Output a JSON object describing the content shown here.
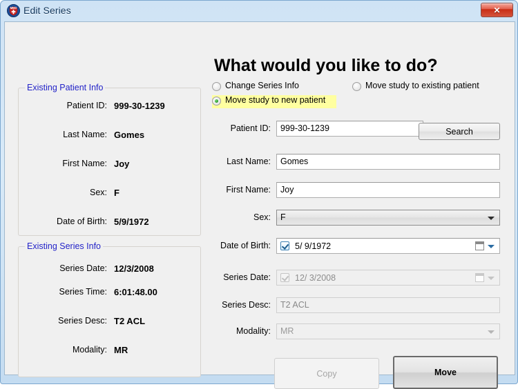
{
  "window": {
    "title": "Edit Series",
    "icon": "med-shield-icon",
    "close_label": "✕",
    "accent_blue": "#2323c8",
    "highlight_yellow": "#ffffa0",
    "close_red": "#c92d15"
  },
  "patient_group": {
    "title": "Existing Patient Info",
    "rows": [
      {
        "label": "Patient ID:",
        "value": "999-30-1239"
      },
      {
        "label": "Last Name:",
        "value": "Gomes"
      },
      {
        "label": "First Name:",
        "value": "Joy"
      },
      {
        "label": "Sex:",
        "value": "F"
      },
      {
        "label": "Date of Birth:",
        "value": "5/9/1972"
      }
    ]
  },
  "series_group": {
    "title": "Existing Series Info",
    "rows": [
      {
        "label": "Series Date:",
        "value": "12/3/2008"
      },
      {
        "label": "Series Time:",
        "value": "6:01:48.00"
      },
      {
        "label": "Series Desc:",
        "value": "T2 ACL"
      },
      {
        "label": "Modality:",
        "value": "MR"
      }
    ]
  },
  "main": {
    "heading": "What would you like to do?",
    "options": [
      {
        "label": "Change Series Info",
        "selected": false,
        "highlighted": false
      },
      {
        "label": "Move study to existing patient",
        "selected": false,
        "highlighted": false
      },
      {
        "label": "Move study to new patient",
        "selected": true,
        "highlighted": true
      }
    ],
    "fields": [
      {
        "label": "Patient ID:",
        "value": "999-30-1239",
        "type": "text",
        "disabled": false
      },
      {
        "label": "Last Name:",
        "value": "Gomes",
        "type": "text",
        "disabled": false
      },
      {
        "label": "First Name:",
        "value": "Joy",
        "type": "text",
        "disabled": false
      },
      {
        "label": "Sex:",
        "value": "F",
        "type": "combo",
        "disabled": false
      },
      {
        "label": "Date of Birth:",
        "value": "5/  9/1972",
        "type": "date",
        "checked": true,
        "disabled": false
      },
      {
        "label": "Series Date:",
        "value": "12/  3/2008",
        "type": "date",
        "checked": true,
        "disabled": true
      },
      {
        "label": "Series Desc:",
        "value": "T2 ACL",
        "type": "text",
        "disabled": true
      },
      {
        "label": "Modality:",
        "value": "MR",
        "type": "combo",
        "disabled": true
      }
    ],
    "search_label": "Search",
    "copy_label": "Copy",
    "move_label": "Move"
  }
}
